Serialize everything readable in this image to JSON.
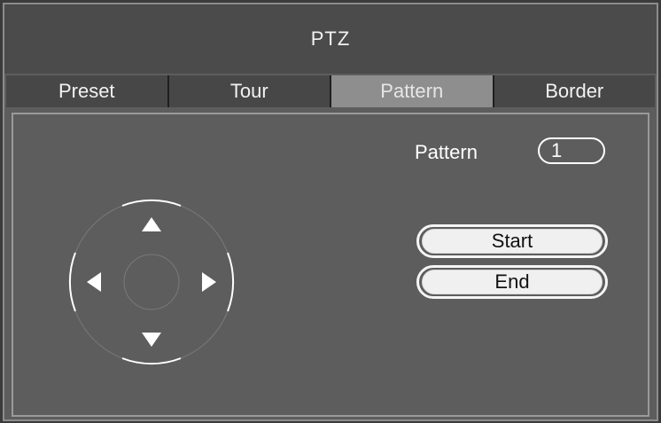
{
  "window": {
    "title": "PTZ"
  },
  "tabs": [
    {
      "label": "Preset",
      "active": false
    },
    {
      "label": "Tour",
      "active": false
    },
    {
      "label": "Pattern",
      "active": true
    },
    {
      "label": "Border",
      "active": false
    }
  ],
  "pattern": {
    "label": "Pattern",
    "value": "1"
  },
  "buttons": {
    "start_label": "Start",
    "end_label": "End"
  },
  "joystick": {
    "directions": [
      "up-arrow-icon",
      "down-arrow-icon",
      "left-arrow-icon",
      "right-arrow-icon"
    ]
  },
  "colors": {
    "panel": "#5d5d5d",
    "title_bar": "#4b4b4b",
    "tab": "#474747",
    "tab_active": "#8e8e8e",
    "button_face": "#f0f0f0"
  }
}
